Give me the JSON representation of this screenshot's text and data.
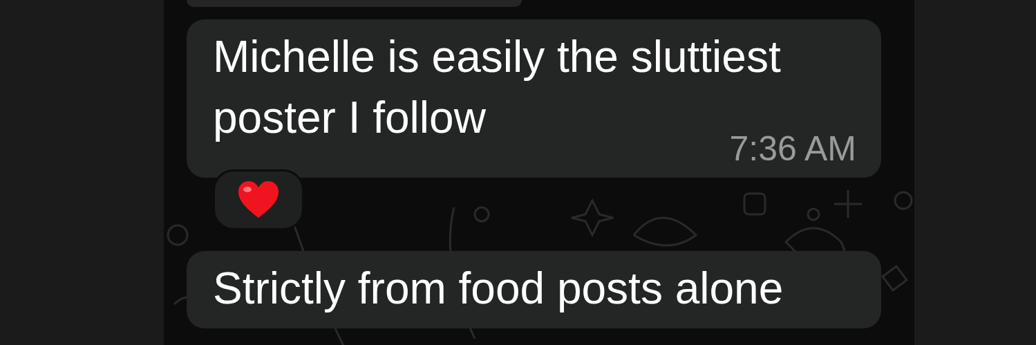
{
  "earlier_message_cut": true,
  "messages": [
    {
      "text": "Michelle is easily the sluttiest poster I follow",
      "time": "7:36 AM",
      "reaction": {
        "kind": "heart"
      }
    },
    {
      "text": "Strictly from food posts alone"
    }
  ]
}
